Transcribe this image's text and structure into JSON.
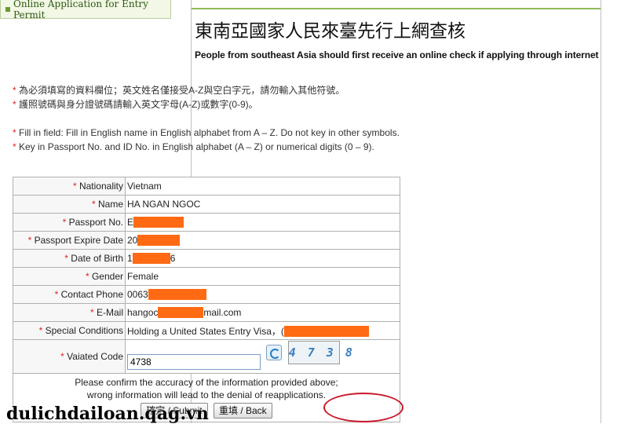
{
  "nav": {
    "item_label": "Online Application for Entry Permit"
  },
  "header": {
    "title": "東南亞國家人民來臺先行上網查核",
    "subtitle": "People from southeast Asia should first receive an online check if applying through internet"
  },
  "notes": {
    "zh": [
      "* 為必須填寫的資料欄位；英文姓名僅接受A-Z與空白字元，請勿輸入其他符號。",
      "* 護照號碼與身分證號碼請輸入英文字母(A-Z)或數字(0-9)。"
    ],
    "en": [
      "* Fill in field: Fill in English name in English alphabet from A – Z. Do not key in other symbols.",
      "* Key in Passport No. and ID No. in English alphabet (A – Z) or numerical digits (0 – 9)."
    ]
  },
  "form": {
    "nationality": {
      "label": "Nationality",
      "value": "Vietnam"
    },
    "name": {
      "label": "Name",
      "value": "HA NGAN NGOC"
    },
    "passport_no": {
      "label": "Passport No.",
      "value": "E"
    },
    "passport_expire": {
      "label": "Passport Expire Date",
      "value": "20"
    },
    "dob": {
      "label": "Date of Birth",
      "prefix": "1",
      "suffix": "6"
    },
    "gender": {
      "label": "Gender",
      "value": "Female"
    },
    "phone": {
      "label": "Contact Phone",
      "value": "0063"
    },
    "email": {
      "label": "E-Mail",
      "prefix": "hangoc",
      "suffix": "mail.com"
    },
    "special": {
      "label": "Special Conditions",
      "value": "Holding a United States Entry Visa，",
      "suffix": "("
    },
    "code": {
      "label": "Vaiated Code",
      "value": "4738",
      "captcha": "4 7 3 8"
    }
  },
  "required_mark": "*",
  "confirm": {
    "line1": "Please confirm the accuracy of the information provided above;",
    "line2": "wrong information will lead to the denial of reapplications.",
    "submit_label": "確定 / Submit",
    "back_label": "重填 / Back"
  },
  "watermark": "dulichdailoan.qag.vn",
  "colors": {
    "redaction": "#ff6a13",
    "required": "#dd2222",
    "annotation_circle": "#c8182a",
    "nav_border": "#8fba5a"
  }
}
